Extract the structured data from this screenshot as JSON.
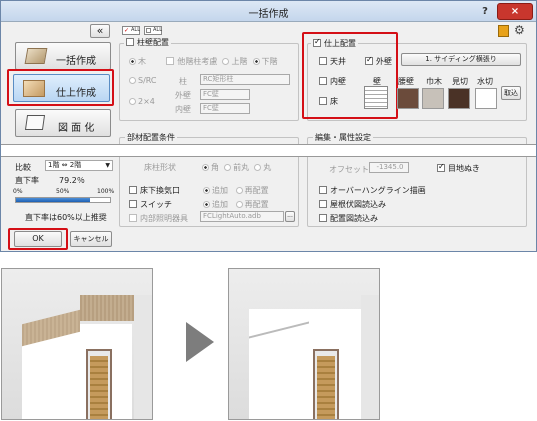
{
  "dialog": {
    "title": "一括作成",
    "help_label": "?",
    "close_label": "×",
    "tabs": [
      {
        "label": "一括作成"
      },
      {
        "label": "仕上作成"
      },
      {
        "label": "図 面 化"
      }
    ],
    "collapse_label": "«",
    "mini_chips": [
      "ALL",
      "ALL"
    ],
    "column_group": {
      "title": "柱壁配置",
      "materials": [
        "木",
        "他階柱考慮",
        "上階",
        "下階"
      ],
      "src_label": "S/RC",
      "two_by_four": "2×4",
      "pillar_label": "柱",
      "pillar_value": "RC矩形柱",
      "outer_wall_label": "外壁",
      "outer_wall_value": "FC壁",
      "inner_wall_label": "内壁",
      "inner_wall_value": "FC壁"
    },
    "finish_group": {
      "title": "仕上配置",
      "checks": [
        "天井",
        "内壁",
        "床"
      ],
      "outer_wall_label": "外壁",
      "siding_button": "1. サイディング横張り",
      "wall_label": "壁",
      "columns": [
        "腰壁",
        "巾木",
        "見切",
        "水切"
      ],
      "import_button": "取込",
      "swatch_colors": [
        "#6b4b3b",
        "#c7c1b9",
        "#4a3226",
        "#ffffff"
      ]
    },
    "members_group": {
      "title": "部材配置条件",
      "shape_label": "床柱形状",
      "shape_options": [
        "角",
        "前丸",
        "丸"
      ],
      "checks": [
        "床下換気口",
        "スイッチ",
        "内部照明器具"
      ],
      "add_label": "追加",
      "replace_label": "再配置",
      "file_value": "FCLightAuto.adb",
      "browse_label": "..."
    },
    "edit_group": {
      "title": "編集・属性設定",
      "offset_label": "オフセット",
      "offset_value": "-1345.0",
      "grain_label": "目地ぬき",
      "checks": [
        "オーバーハングライン描画",
        "屋根伏図読込み",
        "配置図読込み"
      ]
    },
    "ratio": {
      "label": "比較",
      "value": "1階 ⇔ 2階",
      "direct_label": "直下率",
      "direct_value": "79.2％",
      "ticks": [
        "0%",
        "50%",
        "100%"
      ],
      "progress": 0.792,
      "note": "直下率は60%以上推奨"
    },
    "ok_label": "OK",
    "cancel_label": "キャンセル"
  },
  "arrow": "▶"
}
